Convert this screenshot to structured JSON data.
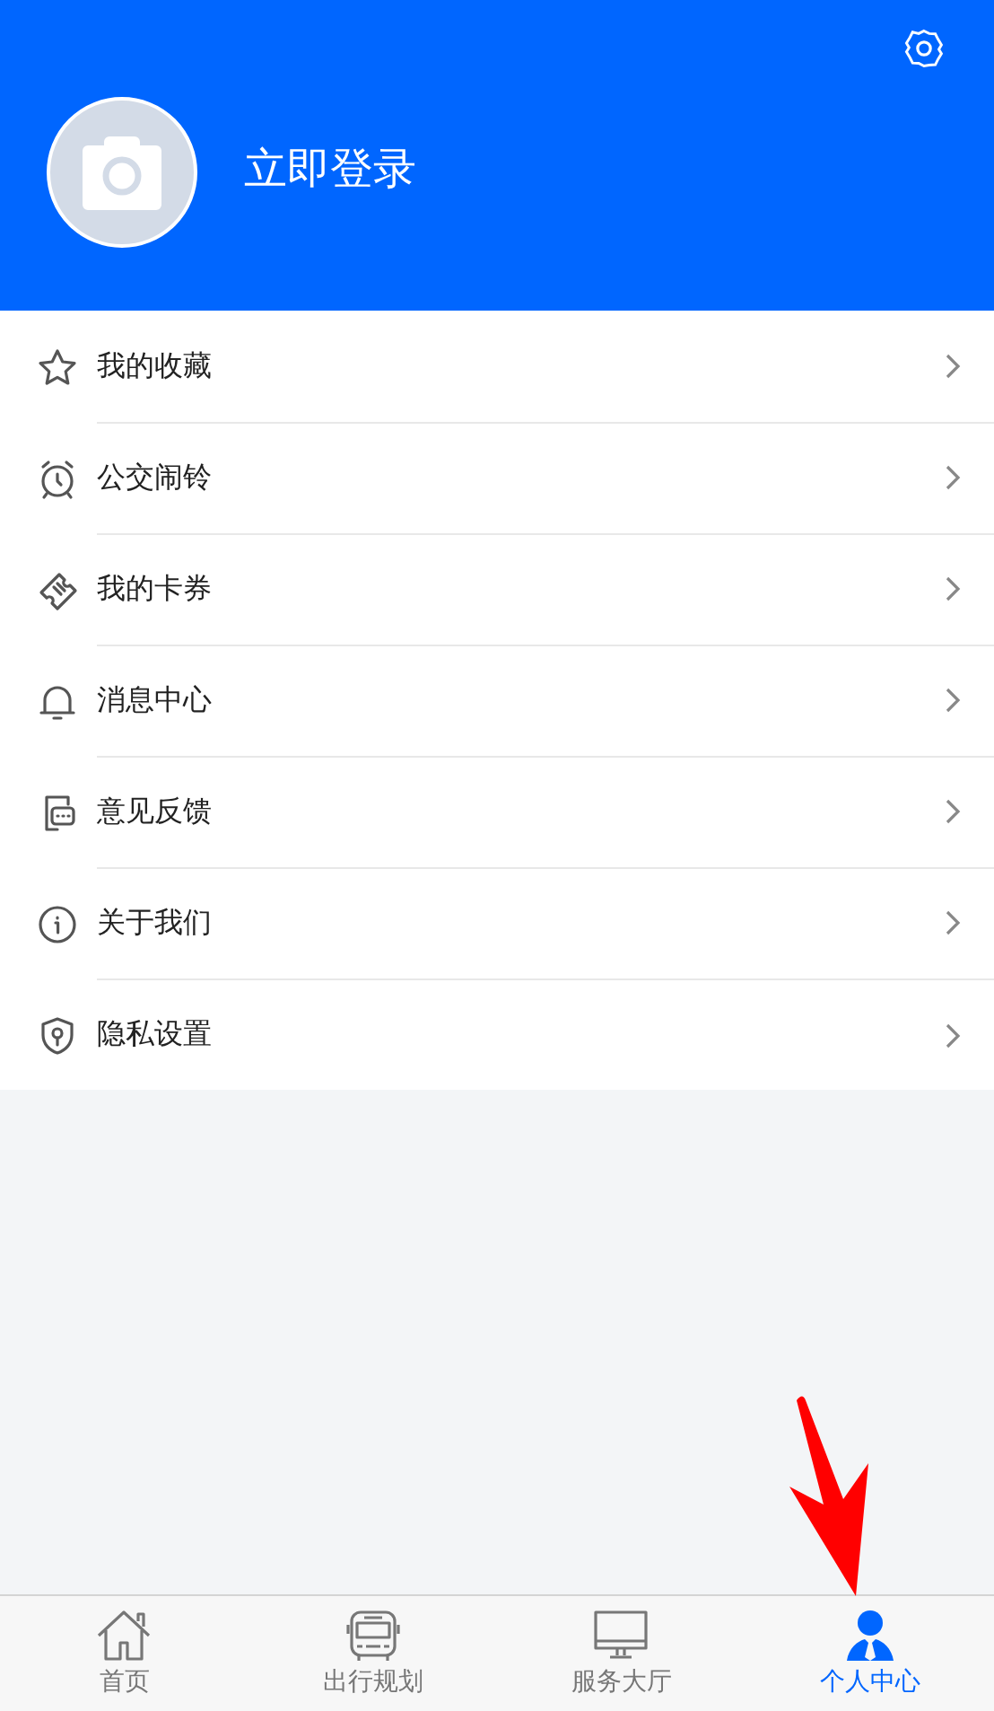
{
  "header": {
    "login_label": "立即登录"
  },
  "menu": [
    {
      "label": "我的收藏"
    },
    {
      "label": "公交闹铃"
    },
    {
      "label": "我的卡券"
    },
    {
      "label": "消息中心"
    },
    {
      "label": "意见反馈"
    },
    {
      "label": "关于我们"
    },
    {
      "label": "隐私设置"
    }
  ],
  "tab_bar": [
    {
      "label": "首页",
      "selected": false
    },
    {
      "label": "出行规划",
      "selected": false
    },
    {
      "label": "服务大厅",
      "selected": false
    },
    {
      "label": "个人中心",
      "selected": true
    }
  ]
}
